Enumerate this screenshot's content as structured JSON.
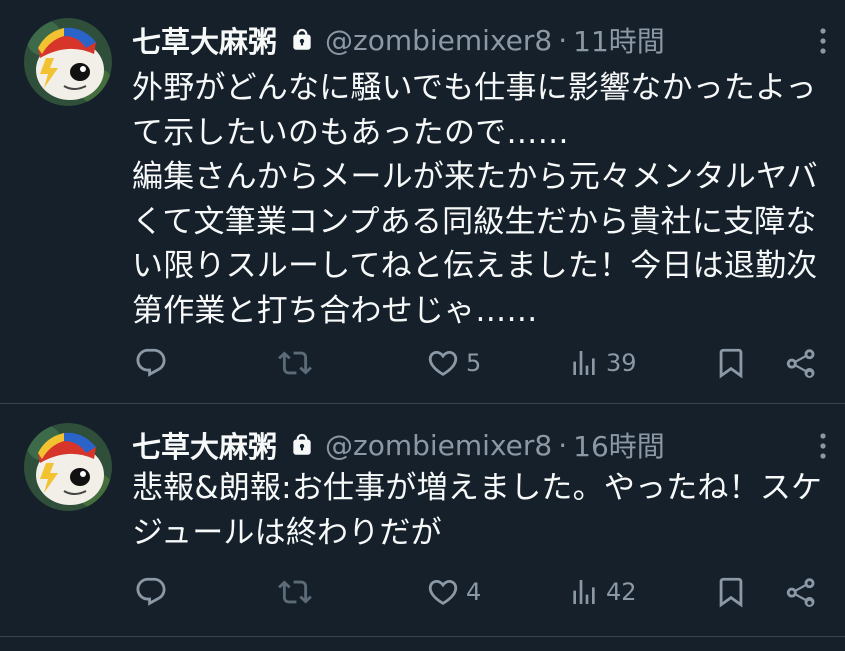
{
  "colors": {
    "background": "#15202b",
    "text_primary": "#f7f9f9",
    "text_secondary": "#8b98a5",
    "divider": "#38444d"
  },
  "tweets": [
    {
      "display_name": "七草大麻粥",
      "handle": "@zombiemixer8",
      "separator": "·",
      "time": "11時間",
      "protected_icon": "lock-icon",
      "text": "外野がどんなに騒いでも仕事に影響なかったよって示したいのもあったので……\n編集さんからメールが来たから元々メンタルヤバくて文筆業コンプある同級生だから貴社に支障ない限りスルーしてねと伝えました！今日は退勤次第作業と打ち合わせじゃ……",
      "actions": {
        "reply_icon": "reply-icon",
        "retweet_icon": "retweet-icon",
        "like_icon": "heart-icon",
        "like_count": "5",
        "views_icon": "views-icon",
        "views_count": "39",
        "bookmark_icon": "bookmark-icon",
        "share_icon": "share-icon"
      }
    },
    {
      "display_name": "七草大麻粥",
      "handle": "@zombiemixer8",
      "separator": "·",
      "time": "16時間",
      "protected_icon": "lock-icon",
      "text": "悲報&朗報:お仕事が増えました。やったね！スケジュールは終わりだが",
      "actions": {
        "reply_icon": "reply-icon",
        "retweet_icon": "retweet-icon",
        "like_icon": "heart-icon",
        "like_count": "4",
        "views_icon": "views-icon",
        "views_count": "42",
        "bookmark_icon": "bookmark-icon",
        "share_icon": "share-icon"
      }
    }
  ]
}
